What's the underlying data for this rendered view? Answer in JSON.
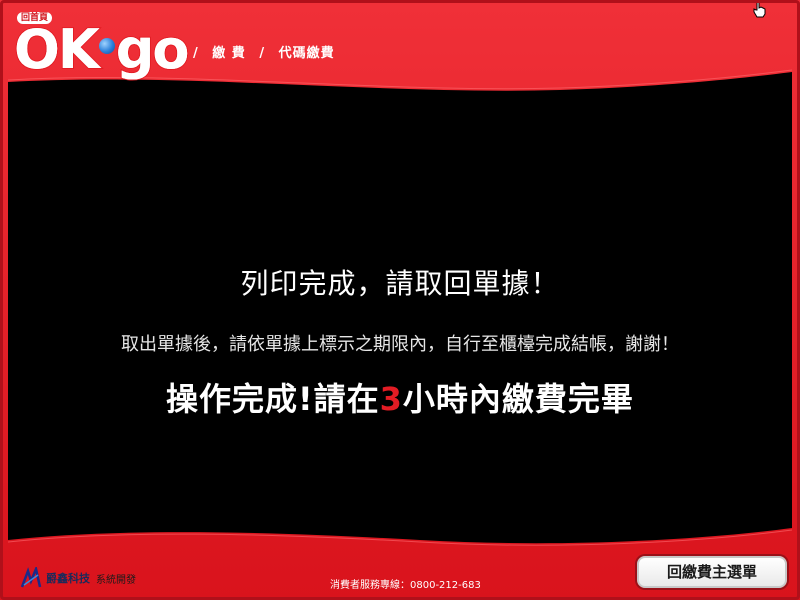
{
  "header": {
    "home_badge": "回首頁",
    "logo_left": "OK",
    "logo_right": "go",
    "breadcrumb": [
      "/",
      "繳 費",
      "/",
      "代碼繳費"
    ]
  },
  "main": {
    "title": "列印完成，請取回單據！",
    "subtitle": "取出單據後，請依單據上標示之期限內，自行至櫃檯完成結帳，謝謝！",
    "alert_prefix": "操作完成!請在",
    "alert_number": "3",
    "alert_suffix": "小時內繳費完畢"
  },
  "footer": {
    "company": "爵鑫科技",
    "developer": "系統開發",
    "hotline": "消費者服務專線：0800-212-683",
    "main_menu_button": "回繳費主選單"
  },
  "colors": {
    "frame": "#e31c24",
    "panel": "#000000",
    "alert_number": "#e31c24"
  },
  "icons": {
    "logo_dot": "globe-dot-icon",
    "cursor": "hand-cursor-icon",
    "footer_mark": "company-logo-icon"
  }
}
